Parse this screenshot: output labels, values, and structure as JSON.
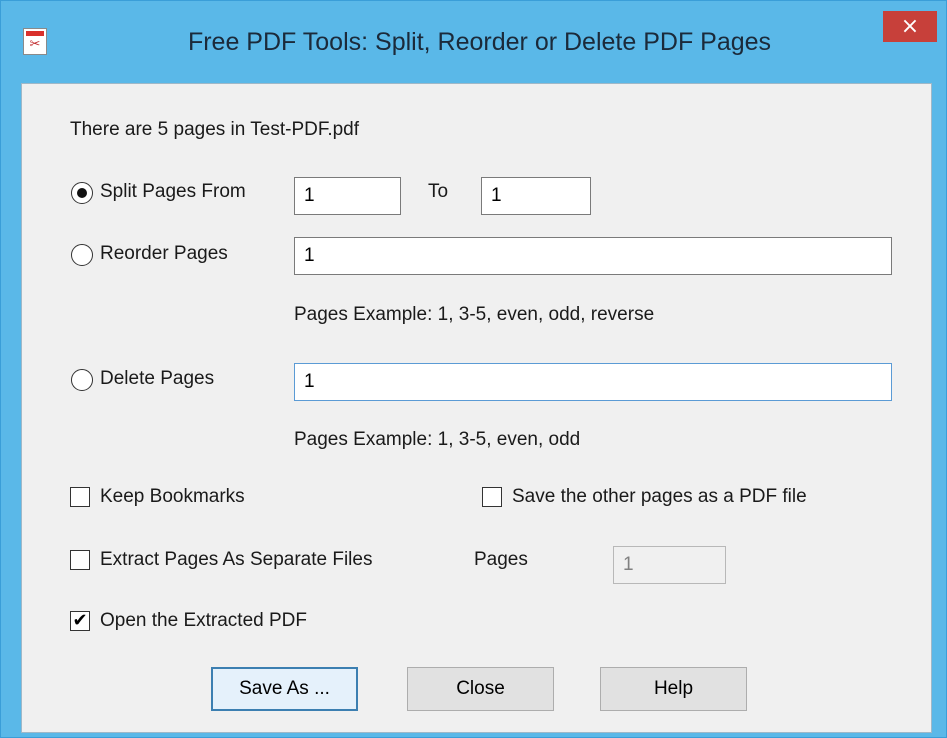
{
  "window": {
    "title": "Free PDF Tools: Split, Reorder or Delete PDF Pages",
    "close_glyph": "×",
    "app_icon": "pdf-tools-app-icon"
  },
  "info_text": "There are 5 pages in Test-PDF.pdf",
  "split": {
    "label": "Split Pages From",
    "selected": true,
    "from_value": "1",
    "to_label": "To",
    "to_value": "1"
  },
  "reorder": {
    "label": "Reorder Pages",
    "selected": false,
    "value": "1",
    "hint": "Pages Example: 1, 3-5, even, odd, reverse"
  },
  "delete": {
    "label": "Delete Pages",
    "selected": false,
    "value": "1",
    "hint": "Pages Example: 1, 3-5, even, odd"
  },
  "options": {
    "keep_bookmarks": {
      "label": "Keep Bookmarks",
      "checked": false
    },
    "save_other": {
      "label": "Save the other pages as a PDF file",
      "checked": false
    },
    "extract_separate": {
      "label": "Extract Pages As Separate Files",
      "checked": false
    },
    "pages_label": "Pages",
    "pages_value": "1",
    "open_extracted": {
      "label": "Open the Extracted PDF",
      "checked": true
    }
  },
  "buttons": {
    "save_as": "Save As ...",
    "close": "Close",
    "help": "Help"
  },
  "colors": {
    "title_bar": "#5ab8e8",
    "close_button": "#c7403a",
    "client_bg": "#f0f0f0"
  }
}
